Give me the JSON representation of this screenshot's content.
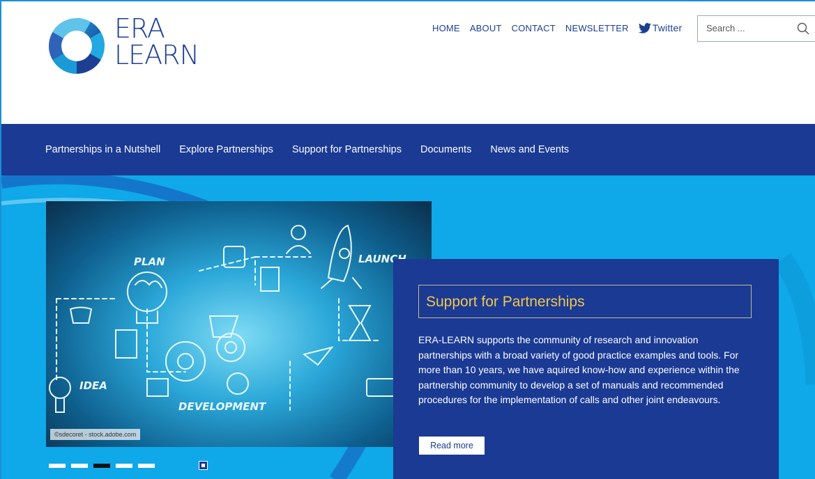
{
  "brand": {
    "line1": "ERA",
    "line2": "LEARN"
  },
  "topnav": {
    "home": "HOME",
    "about": "ABOUT",
    "contact": "CONTACT",
    "newsletter": "NEWSLETTER",
    "twitter": "Twitter"
  },
  "search": {
    "placeholder": "Search ..."
  },
  "mainnav": {
    "items": [
      {
        "label": "Partnerships in a Nutshell"
      },
      {
        "label": "Explore Partnerships"
      },
      {
        "label": "Support for Partnerships"
      },
      {
        "label": "Documents"
      },
      {
        "label": "News and Events"
      }
    ]
  },
  "hero": {
    "image_labels": {
      "plan": "PLAN",
      "launch": "LAUNCH",
      "idea": "IDEA",
      "development": "DEVELOPMENT"
    },
    "credit": "©sdecoret - stock.adobe.com",
    "title": "Support for Partnerships",
    "text": "ERA-LEARN supports the community of research and innovation partnerships with a broad variety of good practice examples and tools. For more than 10 years, we have aquired know-how and experience within the partnership community to develop a set of manuals and recommended procedures for the implementation of calls and other joint endeavours.",
    "read_more": "Read more",
    "slides": 5,
    "active_slide": 3
  },
  "colors": {
    "brand_blue": "#1a3a94",
    "hero_cyan": "#0fa8e8",
    "title_gold": "#f3c64a"
  }
}
